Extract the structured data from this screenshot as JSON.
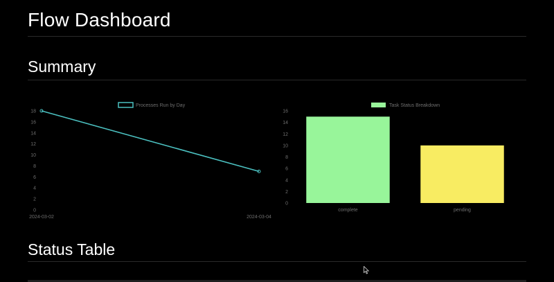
{
  "header": {
    "title": "Flow Dashboard"
  },
  "sections": {
    "summary": "Summary",
    "status_table": "Status Table"
  },
  "colors": {
    "background": "#000000",
    "line": "#4bc0c0",
    "complete": "#98f59a",
    "pending": "#f8ec62",
    "axis_text": "#6f6f6f"
  },
  "chart_data": [
    {
      "type": "line",
      "legend": "Processes Run by Day",
      "x": [
        "2024-03-02",
        "2024-03-04"
      ],
      "series": [
        {
          "name": "Processes Run by Day",
          "values": [
            18,
            7
          ]
        }
      ],
      "yticks": [
        0,
        2,
        4,
        6,
        8,
        10,
        12,
        14,
        16,
        18
      ],
      "ylim": [
        0,
        18
      ],
      "grid": false,
      "legend_position": "top"
    },
    {
      "type": "bar",
      "legend": "Task Status Breakdown",
      "categories": [
        "complete",
        "pending"
      ],
      "series": [
        {
          "name": "Task Status Breakdown",
          "values": [
            15,
            10
          ]
        }
      ],
      "yticks": [
        0,
        2,
        4,
        6,
        8,
        10,
        12,
        14,
        16
      ],
      "ylim": [
        0,
        16
      ],
      "grid": false,
      "legend_position": "top"
    }
  ]
}
